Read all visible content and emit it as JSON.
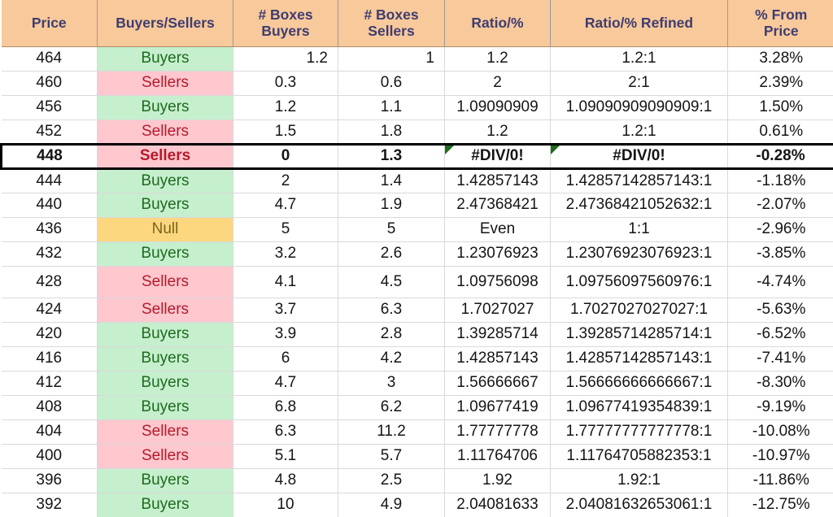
{
  "table": {
    "columns": [
      {
        "label": "Price",
        "name": "col-price"
      },
      {
        "label": "Buyers/Sellers",
        "name": "col-buyers-sellers"
      },
      {
        "label": "# Boxes Buyers",
        "line1": "# Boxes",
        "line2": "Buyers",
        "name": "col-boxes-buyers"
      },
      {
        "label": "# Boxes Sellers",
        "line1": "# Boxes",
        "line2": "Sellers",
        "name": "col-boxes-sellers"
      },
      {
        "label": "Ratio/%",
        "name": "col-ratio-pct"
      },
      {
        "label": "Ratio/% Refined",
        "name": "col-ratio-pct-refined"
      },
      {
        "label": "% From Price",
        "line1": "% From",
        "line2": "Price",
        "name": "col-pct-from-price"
      }
    ],
    "header_colors": {
      "background": "#F8C99B",
      "text": "#3F3D70"
    },
    "fill_colors": {
      "buyers_bg": "#C6EFCE",
      "buyers_text": "#1E6B1E",
      "sellers_bg": "#FFC7CE",
      "sellers_text": "#B31B2C",
      "null_bg": "#FCD77F",
      "null_text": "#7A6519",
      "error_marker": "#1E6B1E",
      "focus_border": "#000000"
    },
    "rows": [
      {
        "price": "464",
        "side": "Buyers",
        "boxes_buyers": "1.2",
        "boxes_sellers": "1",
        "ratio": "1.2",
        "ratio_refined": "1.2:1",
        "pct_from_price": "3.28%",
        "align": "right"
      },
      {
        "price": "460",
        "side": "Sellers",
        "boxes_buyers": "0.3",
        "boxes_sellers": "0.6",
        "ratio": "2",
        "ratio_refined": "2:1",
        "pct_from_price": "2.39%"
      },
      {
        "price": "456",
        "side": "Buyers",
        "boxes_buyers": "1.2",
        "boxes_sellers": "1.1",
        "ratio": "1.09090909",
        "ratio_refined": "1.09090909090909:1",
        "pct_from_price": "1.50%"
      },
      {
        "price": "452",
        "side": "Sellers",
        "boxes_buyers": "1.5",
        "boxes_sellers": "1.8",
        "ratio": "1.2",
        "ratio_refined": "1.2:1",
        "pct_from_price": "0.61%"
      },
      {
        "price": "448",
        "side": "Sellers",
        "boxes_buyers": "0",
        "boxes_sellers": "1.3",
        "ratio": "#DIV/0!",
        "ratio_refined": "#DIV/0!",
        "pct_from_price": "-0.28%",
        "focus": true,
        "error": true
      },
      {
        "price": "444",
        "side": "Buyers",
        "boxes_buyers": "2",
        "boxes_sellers": "1.4",
        "ratio": "1.42857143",
        "ratio_refined": "1.42857142857143:1",
        "pct_from_price": "-1.18%"
      },
      {
        "price": "440",
        "side": "Buyers",
        "boxes_buyers": "4.7",
        "boxes_sellers": "1.9",
        "ratio": "2.47368421",
        "ratio_refined": "2.47368421052632:1",
        "pct_from_price": "-2.07%"
      },
      {
        "price": "436",
        "side": "Null",
        "boxes_buyers": "5",
        "boxes_sellers": "5",
        "ratio": "Even",
        "ratio_refined": "1:1",
        "pct_from_price": "-2.96%"
      },
      {
        "price": "432",
        "side": "Buyers",
        "boxes_buyers": "3.2",
        "boxes_sellers": "2.6",
        "ratio": "1.23076923",
        "ratio_refined": "1.23076923076923:1",
        "pct_from_price": "-3.85%"
      },
      {
        "price": "428",
        "side": "Sellers",
        "boxes_buyers": "4.1",
        "boxes_sellers": "4.5",
        "ratio": "1.09756098",
        "ratio_refined": "1.09756097560976:1",
        "pct_from_price": "-4.74%",
        "tall": true
      },
      {
        "price": "424",
        "side": "Sellers",
        "boxes_buyers": "3.7",
        "boxes_sellers": "6.3",
        "ratio": "1.7027027",
        "ratio_refined": "1.7027027027027:1",
        "pct_from_price": "-5.63%"
      },
      {
        "price": "420",
        "side": "Buyers",
        "boxes_buyers": "3.9",
        "boxes_sellers": "2.8",
        "ratio": "1.39285714",
        "ratio_refined": "1.39285714285714:1",
        "pct_from_price": "-6.52%"
      },
      {
        "price": "416",
        "side": "Buyers",
        "boxes_buyers": "6",
        "boxes_sellers": "4.2",
        "ratio": "1.42857143",
        "ratio_refined": "1.42857142857143:1",
        "pct_from_price": "-7.41%"
      },
      {
        "price": "412",
        "side": "Buyers",
        "boxes_buyers": "4.7",
        "boxes_sellers": "3",
        "ratio": "1.56666667",
        "ratio_refined": "1.56666666666667:1",
        "pct_from_price": "-8.30%"
      },
      {
        "price": "408",
        "side": "Buyers",
        "boxes_buyers": "6.8",
        "boxes_sellers": "6.2",
        "ratio": "1.09677419",
        "ratio_refined": "1.09677419354839:1",
        "pct_from_price": "-9.19%"
      },
      {
        "price": "404",
        "side": "Sellers",
        "boxes_buyers": "6.3",
        "boxes_sellers": "11.2",
        "ratio": "1.77777778",
        "ratio_refined": "1.77777777777778:1",
        "pct_from_price": "-10.08%"
      },
      {
        "price": "400",
        "side": "Sellers",
        "boxes_buyers": "5.1",
        "boxes_sellers": "5.7",
        "ratio": "1.11764706",
        "ratio_refined": "1.11764705882353:1",
        "pct_from_price": "-10.97%"
      },
      {
        "price": "396",
        "side": "Buyers",
        "boxes_buyers": "4.8",
        "boxes_sellers": "2.5",
        "ratio": "1.92",
        "ratio_refined": "1.92:1",
        "pct_from_price": "-11.86%"
      },
      {
        "price": "392",
        "side": "Buyers",
        "boxes_buyers": "10",
        "boxes_sellers": "4.9",
        "ratio": "2.04081633",
        "ratio_refined": "2.04081632653061:1",
        "pct_from_price": "-12.75%"
      }
    ]
  }
}
